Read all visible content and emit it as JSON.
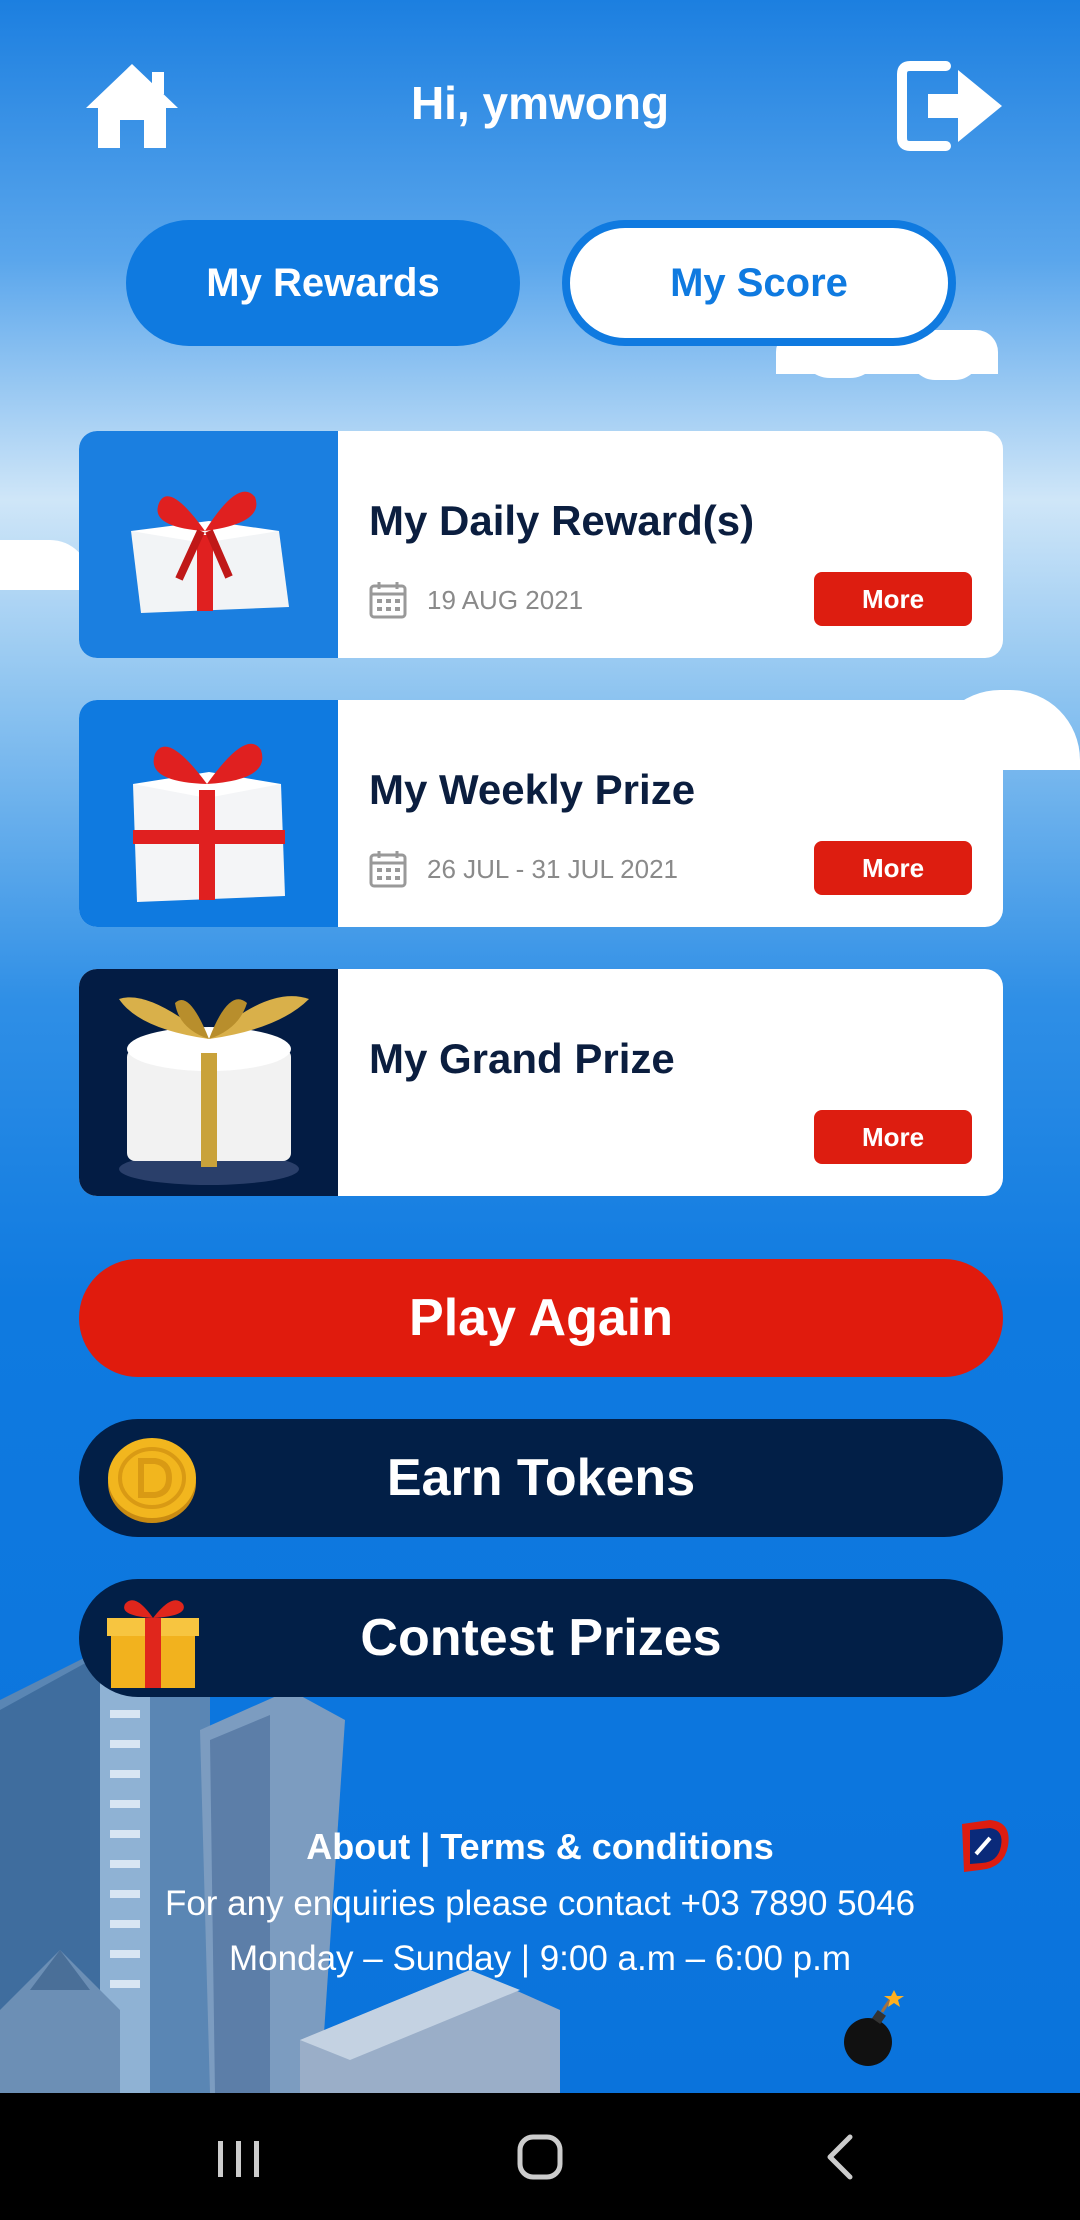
{
  "header": {
    "greeting": "Hi, ymwong"
  },
  "tabs": [
    {
      "label": "My Rewards",
      "active": true
    },
    {
      "label": "My Score",
      "active": false
    }
  ],
  "cards": [
    {
      "title": "My Daily Reward(s)",
      "date": "19 AUG 2021",
      "more_label": "More",
      "image_bg": "#1b7fe0",
      "icon": "gift-box-red-ribbon-icon"
    },
    {
      "title": "My Weekly Prize",
      "date": "26 JUL - 31 JUL 2021",
      "more_label": "More",
      "image_bg": "#0f7ae0",
      "icon": "gift-box-red-ribbon-icon"
    },
    {
      "title": "My Grand Prize",
      "more_label": "More",
      "image_bg": "#031c44",
      "icon": "gift-box-gold-ribbon-icon"
    }
  ],
  "buttons": {
    "play_again": "Play Again",
    "earn_tokens": "Earn Tokens",
    "contest_prizes": "Contest Prizes"
  },
  "footer": {
    "about": "About",
    "separator": "|",
    "terms": "Terms & conditions",
    "contact": "For any enquiries please contact +03 7890 5046",
    "hours": "Monday – Sunday | 9:00 a.m – 6:00 p.m"
  },
  "colors": {
    "accent_blue": "#0f7ae0",
    "more_red": "#dd1d10",
    "play_red": "#e01b0d",
    "navy": "#021f47"
  }
}
